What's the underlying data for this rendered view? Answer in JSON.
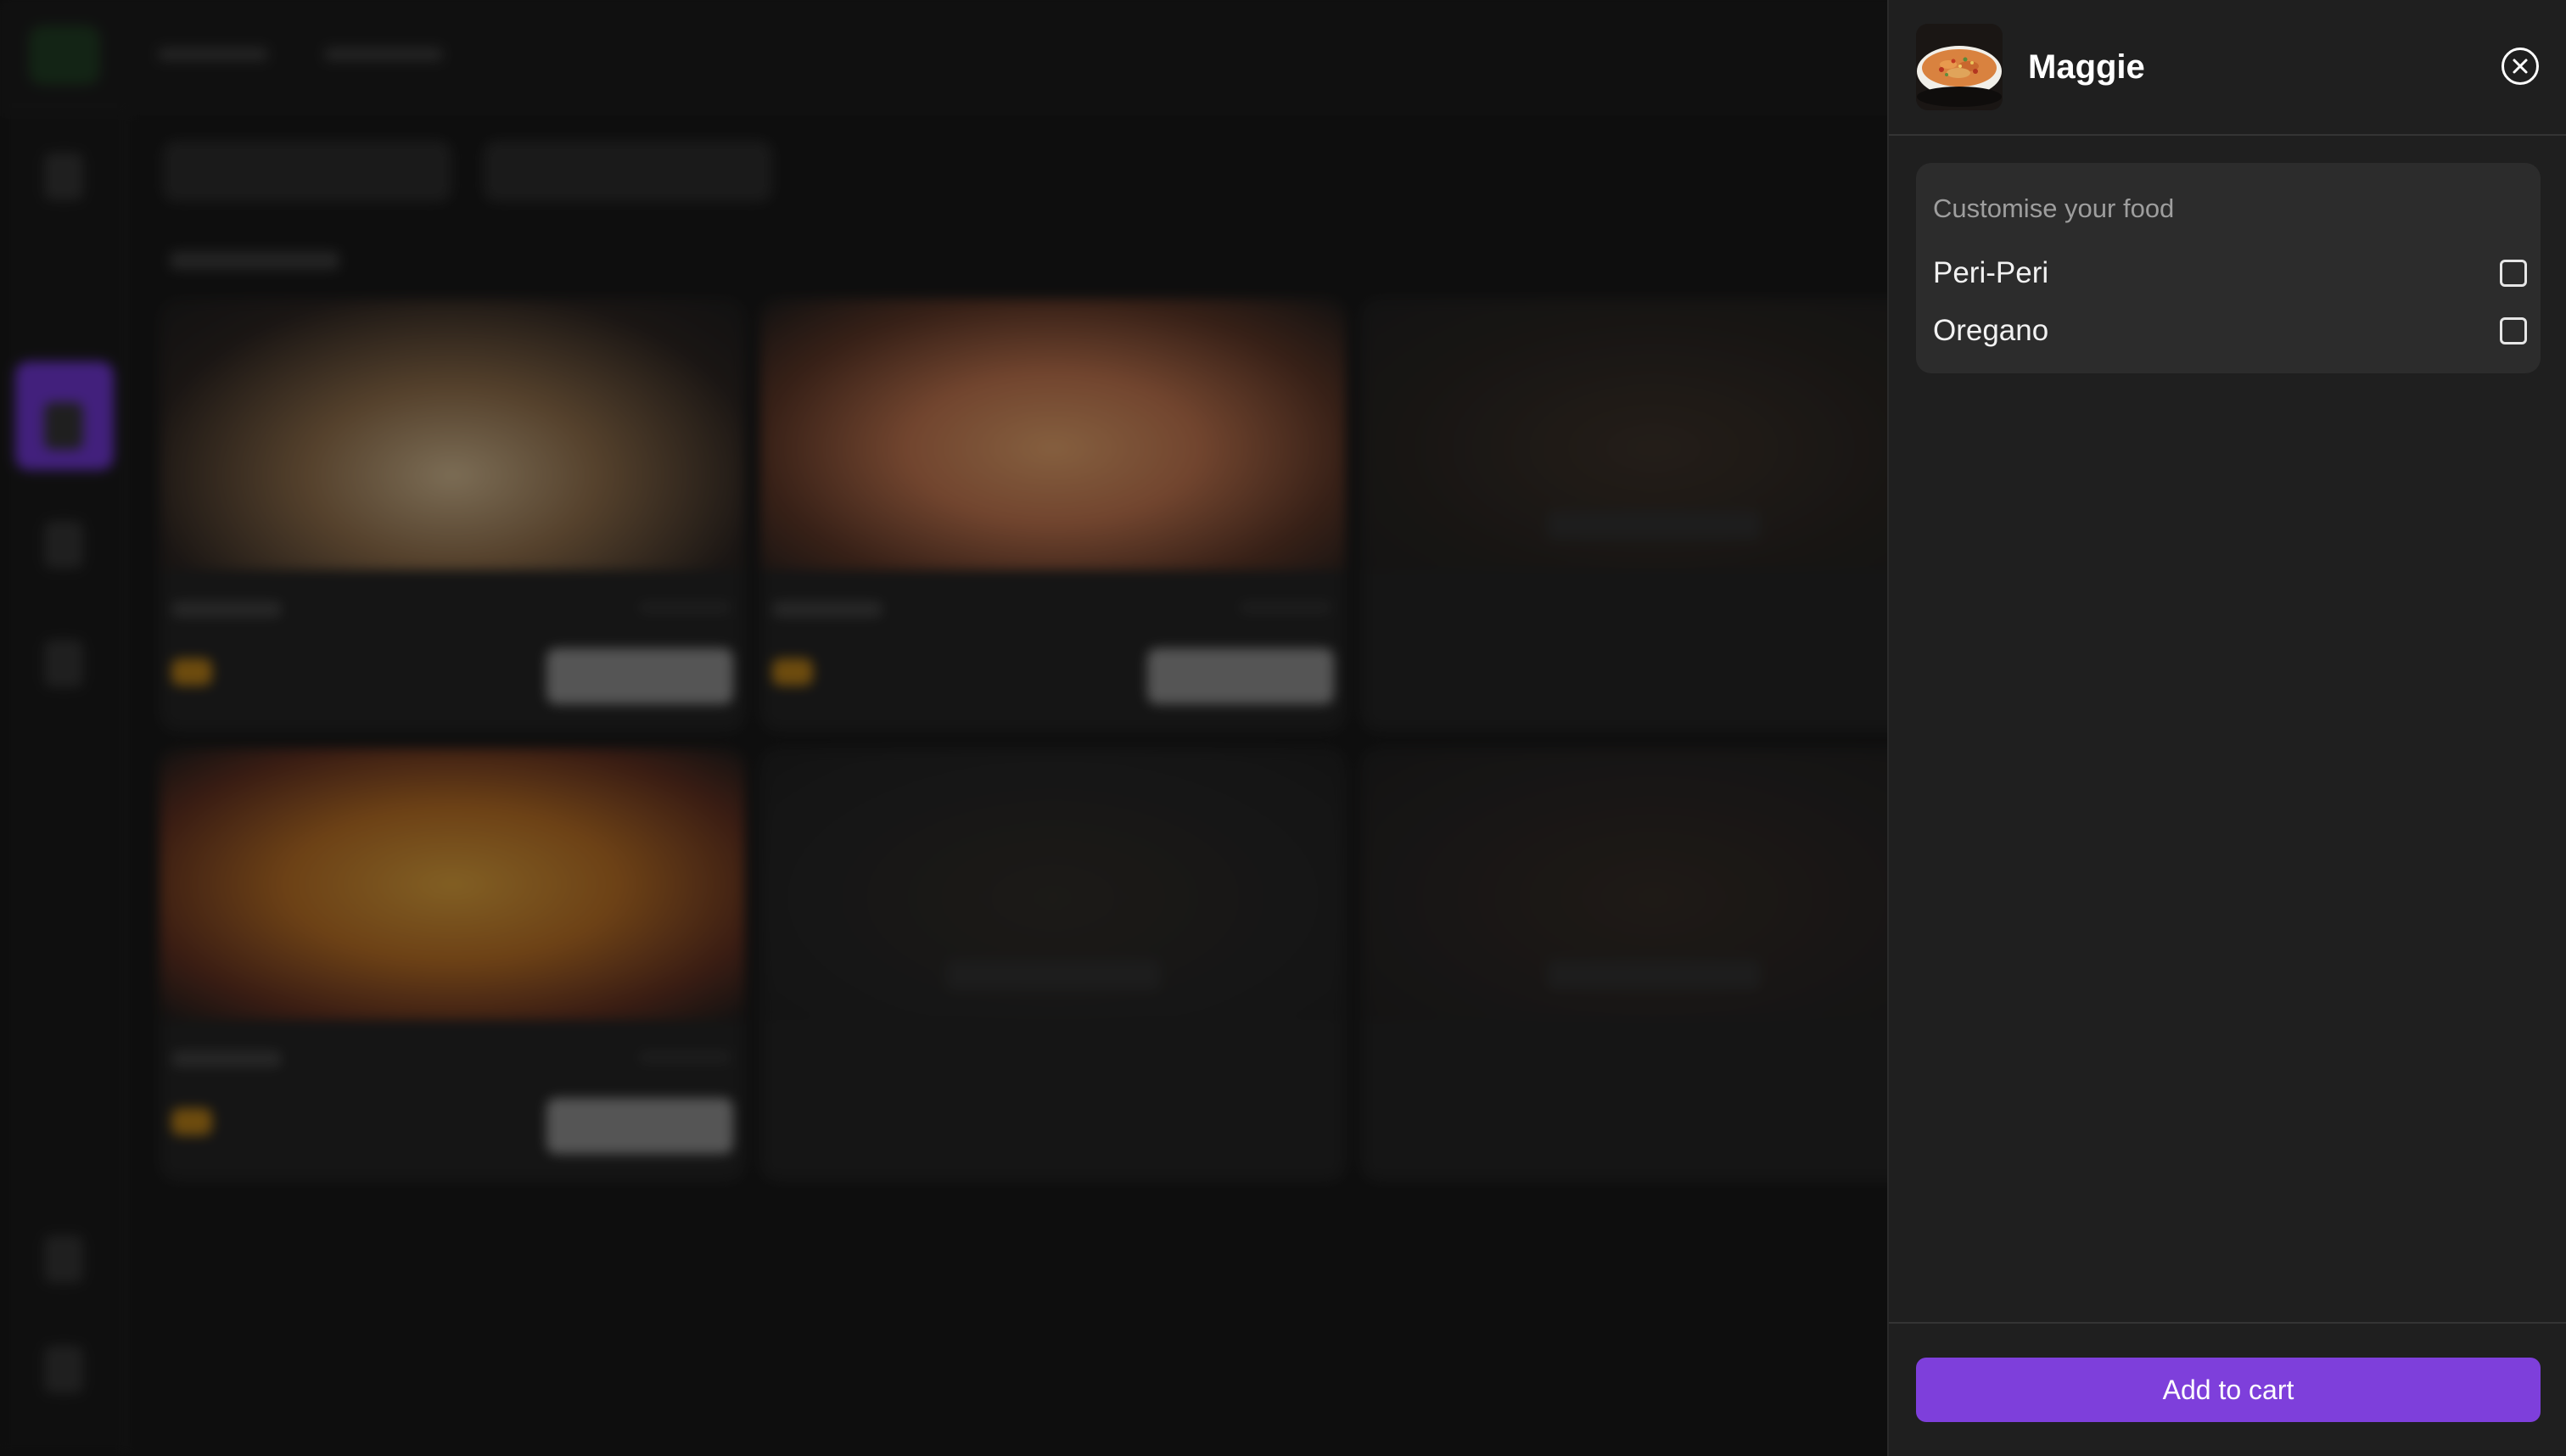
{
  "drawer": {
    "title": "Maggie",
    "customise_heading": "Customise your food",
    "options": [
      {
        "label": "Peri-Peri",
        "checked": false
      },
      {
        "label": "Oregano",
        "checked": false
      }
    ],
    "add_to_cart_label": "Add to cart"
  },
  "colors": {
    "accent": "#7e3fdb",
    "drawer_bg": "#1f1f1f",
    "panel_bg": "#2c2c2c",
    "muted_text": "#9e9e9e"
  },
  "icons": {
    "close": "close-circle-icon",
    "thumbnail": "maggie-food-thumbnail"
  }
}
